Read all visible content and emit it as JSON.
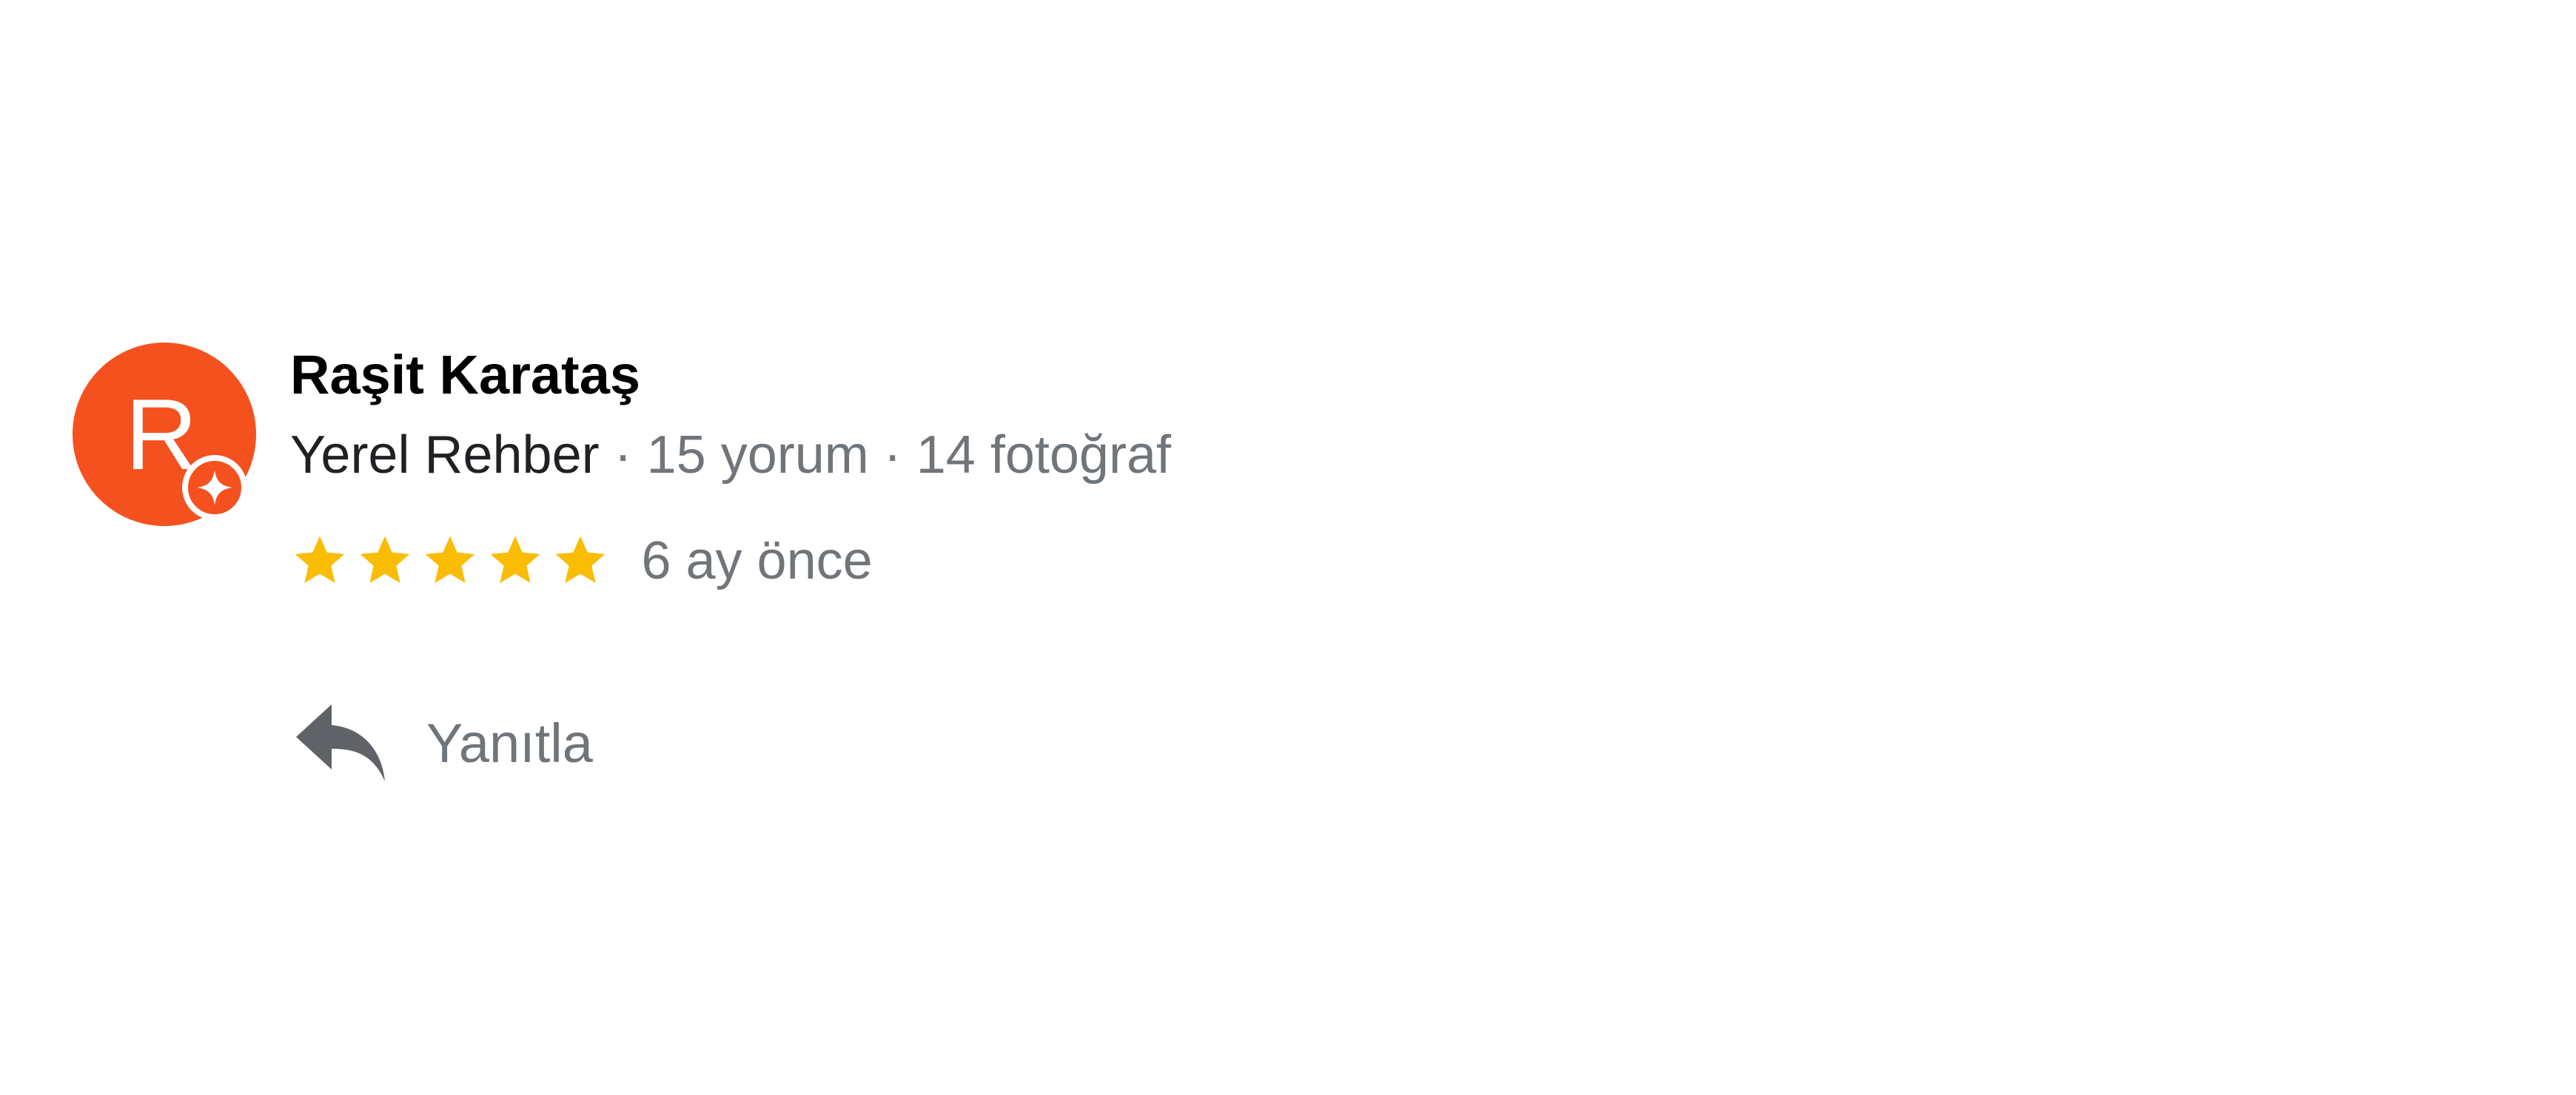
{
  "review": {
    "author": {
      "initial": "R",
      "name": "Raşit Karataş",
      "avatar_color": "#f4511e",
      "badge_icon": "local-guide-star-icon"
    },
    "meta": {
      "guide_label": "Yerel Rehber",
      "separator": " · ",
      "review_count": "15 yorum",
      "photo_count": "14 fotoğraf"
    },
    "rating": {
      "stars": 5,
      "max_stars": 5,
      "star_color": "#fbbc04"
    },
    "date": "6 ay önce",
    "actions": {
      "reply_label": "Yanıtla",
      "reply_icon": "reply-arrow-icon"
    }
  }
}
